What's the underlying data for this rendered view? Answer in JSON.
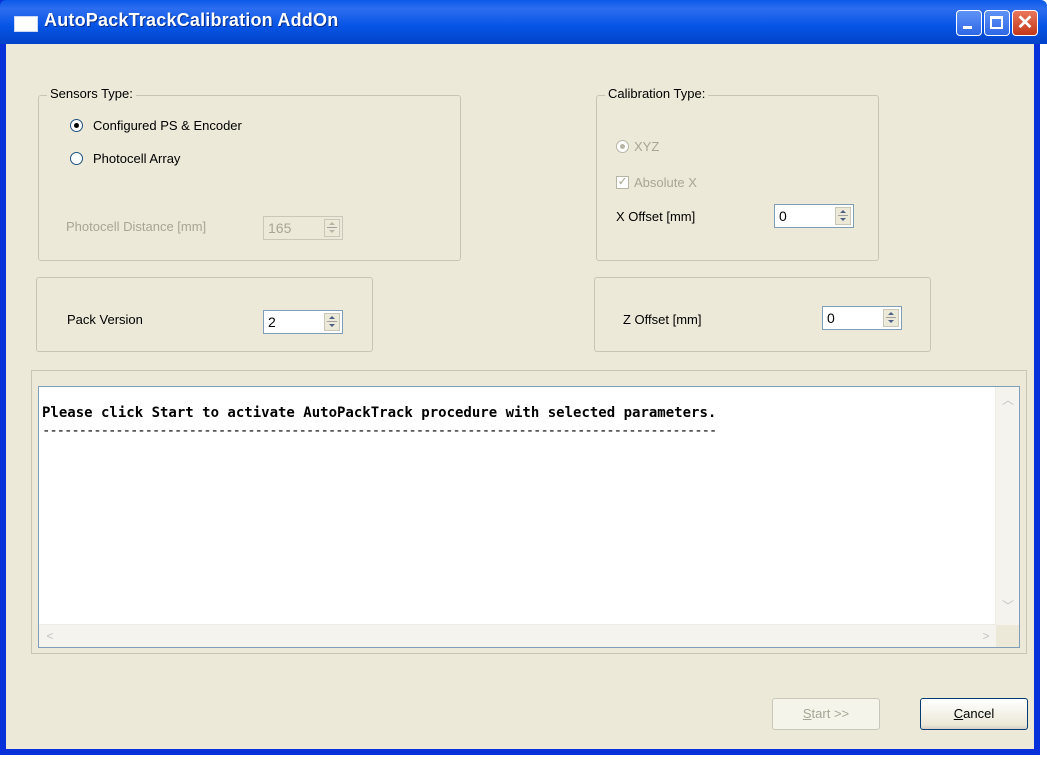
{
  "window": {
    "title": "AutoPackTrackCalibration AddOn"
  },
  "sensors_type": {
    "legend": "Sensors Type:",
    "options": [
      {
        "label": "Configured PS & Encoder",
        "checked": true
      },
      {
        "label": "Photocell Array",
        "checked": false
      }
    ],
    "photocell_distance_label": "Photocell Distance [mm]",
    "photocell_distance_value": "165"
  },
  "calibration_type": {
    "legend": "Calibration Type:",
    "xyz_label": "XYZ",
    "absolute_x_label": "Absolute X",
    "absolute_x_checked": true,
    "x_offset_label": "X Offset [mm]",
    "x_offset_value": "0"
  },
  "pack_version": {
    "label": "Pack Version",
    "value": "2"
  },
  "z_offset": {
    "label": "Z Offset [mm]",
    "value": "0"
  },
  "log": {
    "message": "Please click Start to activate AutoPackTrack procedure with selected parameters.",
    "separator": "--------------------------------------------------------------------------------------------"
  },
  "buttons": {
    "start_first": "S",
    "start_rest": "tart >>",
    "cancel_first": "C",
    "cancel_rest": "ancel"
  },
  "colors": {
    "titlebar": "#0a5ae8",
    "window_bg": "#ece9d8",
    "disabled_text": "#a7a595"
  }
}
